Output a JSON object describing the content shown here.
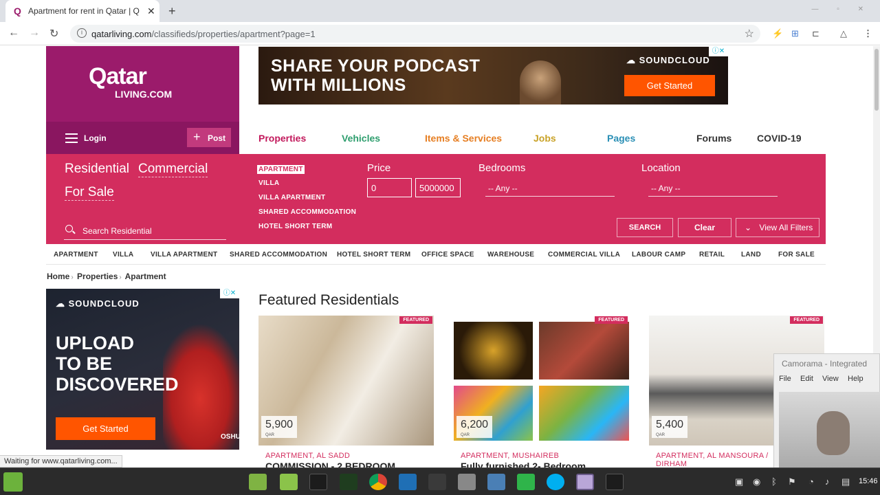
{
  "browser": {
    "tab_title": "Apartment for rent in Qatar | Q",
    "tab_icon": "Q",
    "new_tab": "+",
    "url_host": "qatarliving.com",
    "url_path": "/classifieds/properties/apartment?page=1",
    "status_text": "Waiting for www.qatarliving.com..."
  },
  "site": {
    "logo": "Qatar",
    "logo_sub": "LIVING.COM",
    "login_label": "Login",
    "post_label": "Post",
    "nav": [
      {
        "label": "Properties",
        "color": "#c2185b"
      },
      {
        "label": "Vehicles",
        "color": "#2e9e6e"
      },
      {
        "label": "Items & Services",
        "color": "#e67e22"
      },
      {
        "label": "Jobs",
        "color": "#c9a227"
      },
      {
        "label": "Pages",
        "color": "#2a8fb5"
      },
      {
        "label": "Forums",
        "color": "#333333"
      },
      {
        "label": "COVID-19",
        "color": "#333333"
      }
    ]
  },
  "ads": {
    "top_headline_1": "SHARE YOUR PODCAST",
    "top_headline_2": "WITH MILLIONS",
    "top_brand": "SOUNDCLOUD",
    "top_cta": "Get Started",
    "side_brand": "SOUNDCLOUD",
    "side_headline_1": "UPLOAD",
    "side_headline_2": "TO BE",
    "side_headline_3": "DISCOVERED",
    "side_cta": "Get Started",
    "side_tag": "OSHUN"
  },
  "filters": {
    "residential": "Residential",
    "commercial": "Commercial",
    "for_sale": "For Sale",
    "types": [
      "APARTMENT",
      "VILLA",
      "VILLA APARTMENT",
      "SHARED ACCOMMODATION",
      "HOTEL SHORT TERM"
    ],
    "price_label": "Price",
    "price_min": "0",
    "price_max": "5000000",
    "bedrooms_label": "Bedrooms",
    "bedrooms_value": "-- Any --",
    "location_label": "Location",
    "location_value": "-- Any --",
    "search_placeholder": "Search Residential",
    "search_button": "SEARCH",
    "clear_button": "Clear",
    "view_filters_button": "View All Filters"
  },
  "subnav": [
    "APARTMENT",
    "VILLA",
    "VILLA APARTMENT",
    "SHARED ACCOMMODATION",
    "HOTEL SHORT TERM",
    "OFFICE SPACE",
    "WAREHOUSE",
    "COMMERCIAL VILLA",
    "LABOUR CAMP",
    "RETAIL",
    "LAND",
    "FOR SALE"
  ],
  "breadcrumb": [
    "Home",
    "Properties",
    "Apartment"
  ],
  "featured": {
    "title": "Featured Residentials",
    "badge": "FEATURED",
    "cards": [
      {
        "price": "5,900",
        "currency": "QAR",
        "location": "APARTMENT, AL SADD",
        "title": "COMMISSION - 2 BEDROOM"
      },
      {
        "price": "6,200",
        "currency": "QAR",
        "location": "APARTMENT, MUSHAIREB",
        "title": "Fully furnished 2- Bedroom"
      },
      {
        "price": "5,400",
        "currency": "QAR",
        "location": "APARTMENT, AL MANSOURA /",
        "location2": "DIRHAM"
      }
    ]
  },
  "camorama": {
    "title": "Camorama - Integrated",
    "menu": [
      "File",
      "Edit",
      "View",
      "Help"
    ]
  },
  "taskbar": {
    "clock": "15:46"
  }
}
